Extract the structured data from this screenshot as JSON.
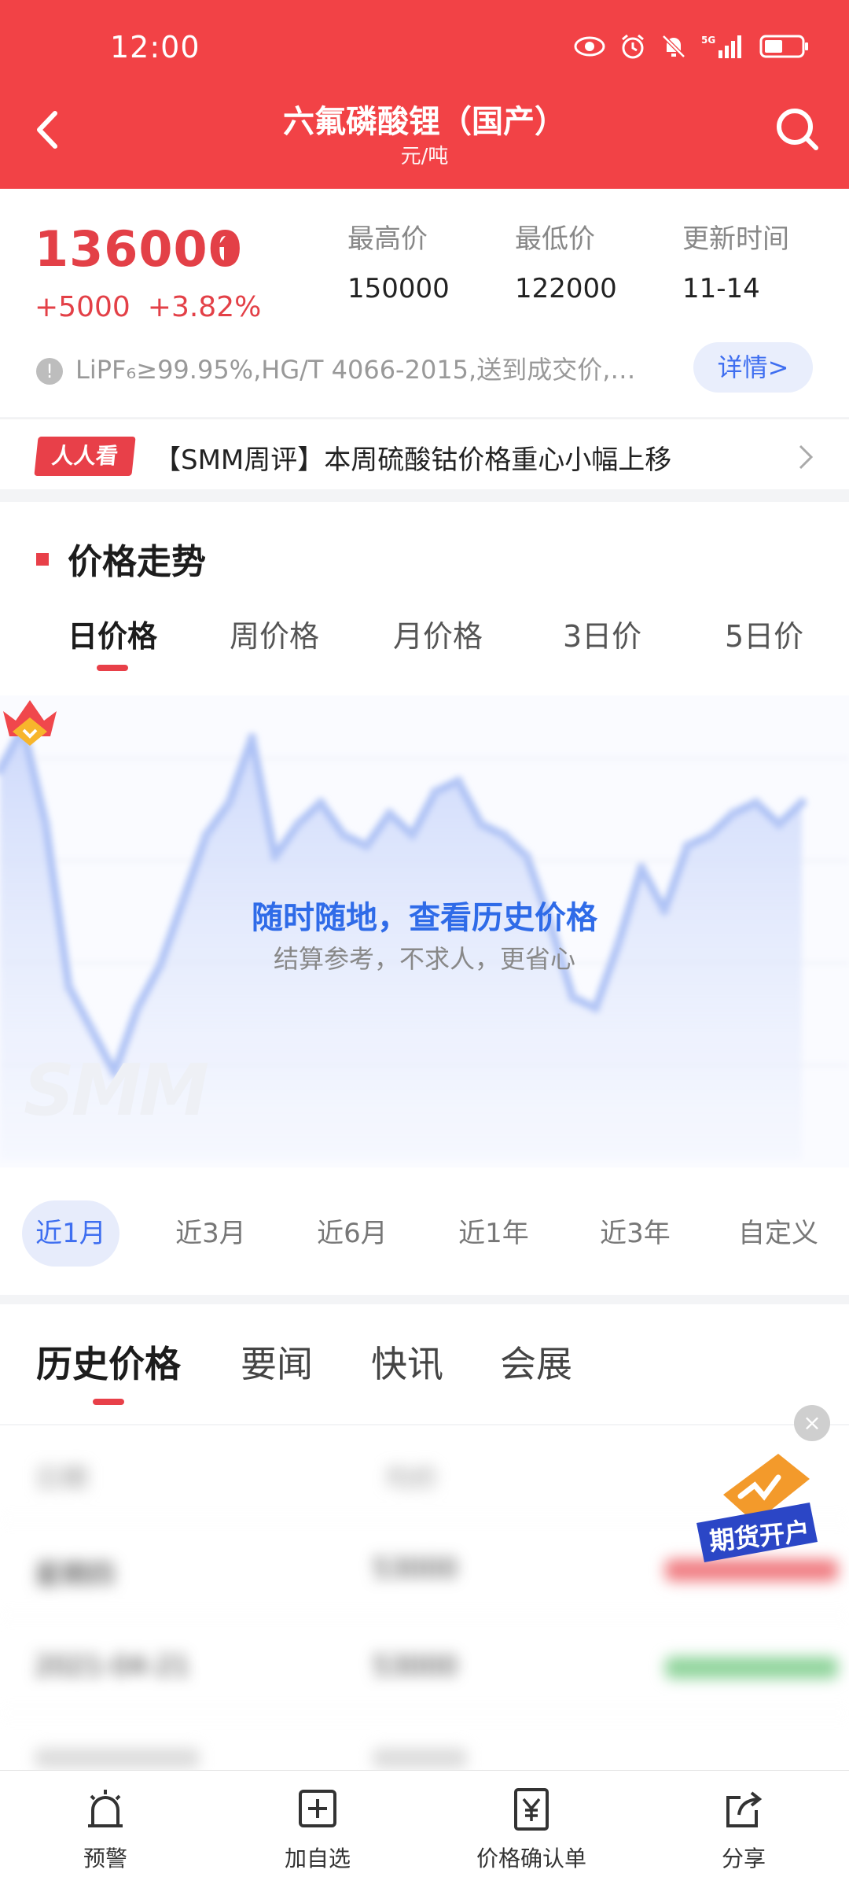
{
  "status": {
    "time": "12:00"
  },
  "header": {
    "title": "六氟磷酸锂（国产）",
    "unit": "元/吨"
  },
  "price": {
    "current": "136000",
    "change_abs": "+5000",
    "change_pct": "+3.82%",
    "high_label": "最高价",
    "high_value": "150000",
    "low_label": "最低价",
    "low_value": "122000",
    "update_label": "更新时间",
    "update_value": "11-14",
    "spec": "LiPF₆≥99.95%,HG/T 4066-2015,送到成交价,…",
    "detail_button": "详情>"
  },
  "ticker": {
    "tag": "人人看",
    "text": "【SMM周评】本周硫酸钴价格重心小幅上移"
  },
  "trend": {
    "title": "价格走势",
    "tabs": [
      "日价格",
      "周价格",
      "月价格",
      "3日价",
      "5日价"
    ],
    "active_tab": 0,
    "overlay_title": "随时随地，查看历史价格",
    "overlay_subtitle": "结算参考，不求人，更省心",
    "watermark": "SMM"
  },
  "chart_data": {
    "type": "line",
    "title": "",
    "values": [
      146,
      150,
      141,
      126,
      122,
      118,
      124,
      128,
      134,
      140,
      143,
      149,
      138,
      141,
      143,
      140,
      139,
      142,
      140,
      144,
      145,
      141,
      140,
      138,
      132,
      125,
      124,
      130,
      137,
      133,
      139,
      140,
      142,
      143,
      141,
      143
    ]
  },
  "ranges": {
    "items": [
      "近1月",
      "近3月",
      "近6月",
      "近1年",
      "近3年",
      "自定义"
    ],
    "active": 0
  },
  "content_tabs": {
    "items": [
      "历史价格",
      "要闻",
      "快讯",
      "会展"
    ],
    "active": 0
  },
  "history": {
    "header": [
      "日期",
      "均价"
    ],
    "rows": [
      [
        "星期四",
        "53000"
      ],
      [
        "2021-04-21",
        "53000"
      ]
    ]
  },
  "ad": {
    "label": "期货开户",
    "close": "×"
  },
  "bottom_nav": {
    "items": [
      "预警",
      "加自选",
      "价格确认单",
      "分享"
    ]
  },
  "colors": {
    "brand_red": "#f24246",
    "up_red": "#e34047",
    "accent_blue": "#3e6ef0"
  }
}
